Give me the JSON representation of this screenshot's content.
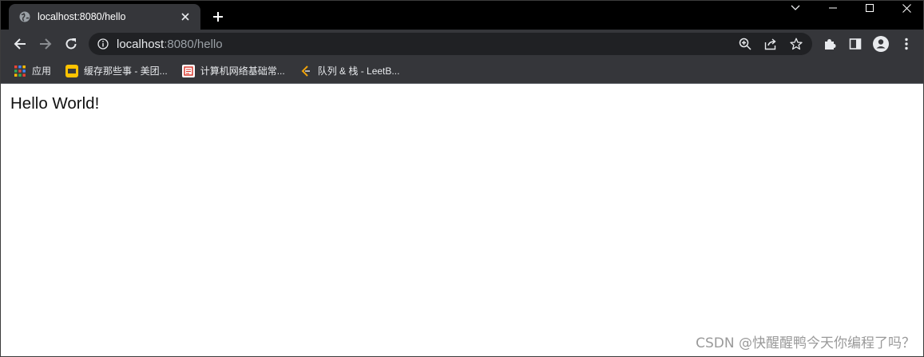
{
  "browser": {
    "tab": {
      "title": "localhost:8080/hello",
      "favicon": "globe-icon"
    },
    "new_tab": "plus-icon",
    "window_controls": [
      "chevron-down-icon",
      "minimize-icon",
      "maximize-icon",
      "close-icon"
    ],
    "toolbar": {
      "back": "arrow-left-icon",
      "forward": "arrow-right-icon",
      "reload": "reload-icon",
      "address": {
        "host": "localhost",
        "rest": ":8080/hello"
      },
      "omnibox_actions": [
        "zoom-icon",
        "share-icon",
        "star-icon"
      ],
      "extension_actions": [
        "puzzle-icon",
        "side-panel-icon",
        "profile-icon",
        "kebab-menu-icon"
      ]
    },
    "bookmarks": [
      {
        "label": "应用",
        "icon": "apps-grid-icon"
      },
      {
        "label": "缓存那些事 - 美团...",
        "icon": "meituan-icon"
      },
      {
        "label": "计算机网络基础常...",
        "icon": "site-icon"
      },
      {
        "label": "队列 & 栈 - LeetB...",
        "icon": "leetcode-icon"
      }
    ]
  },
  "page": {
    "content": "Hello World!",
    "watermark": "CSDN @快醒醒鸭今天你编程了吗？"
  },
  "colors": {
    "tabstrip": "#000000",
    "toolbar": "#35363a",
    "omnibox": "#202124",
    "meituan_yellow": "#ffc300"
  }
}
